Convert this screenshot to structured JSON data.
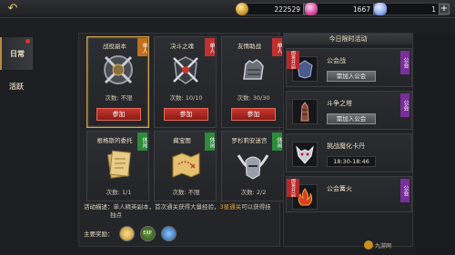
{
  "topbar": {
    "back_icon": "back-arrow-icon",
    "resources": [
      {
        "name": "gold",
        "icon": "gold-coin-icon",
        "value": "222529"
      },
      {
        "name": "gem",
        "icon": "pink-gem-icon",
        "value": "1667"
      },
      {
        "name": "crystal",
        "icon": "blue-crystal-icon",
        "value": "1"
      }
    ],
    "plus": "+"
  },
  "sidebar": {
    "tabs": [
      {
        "label": "日常",
        "active": true
      },
      {
        "label": "活跃",
        "active": false
      }
    ]
  },
  "cards": [
    {
      "title": "战役副本",
      "tag": "单人",
      "tag_type": "solo",
      "count": "次数: 不限",
      "button": "参加",
      "art": "shield-axes-icon",
      "selected": true
    },
    {
      "title": "决斗之魂",
      "tag": "单人",
      "tag_type": "team",
      "count": "次数: 10/10",
      "button": "参加",
      "art": "crossed-swords-shield-icon",
      "selected": false
    },
    {
      "title": "友情助战",
      "tag": "单人",
      "tag_type": "team",
      "count": "次数: 30/30",
      "button": "参加",
      "art": "gauntlet-icon",
      "selected": false
    },
    {
      "title": "根格斯的委托",
      "tag": "休闲",
      "tag_type": "rest",
      "count": "次数: 1/1",
      "button": "",
      "art": "scroll-paper-icon",
      "selected": false
    },
    {
      "title": "藏宝图",
      "tag": "休闲",
      "tag_type": "rest",
      "count": "次数: 不限",
      "button": "",
      "art": "treasure-map-icon",
      "selected": false
    },
    {
      "title": "罗杉莉安迷宫",
      "tag": "休闲",
      "tag_type": "rest",
      "count": "次数: 2/2",
      "button": "",
      "art": "horned-helmet-icon",
      "selected": false
    }
  ],
  "description": {
    "label": "活动描述：",
    "text_a": "单人精英副本，首次通关获得大量经验，",
    "text_hi": "3星通关",
    "text_b": "可以获得挂",
    "text_c": "独点"
  },
  "rewards": {
    "label": "主要奖励：",
    "items": [
      {
        "icon": "gold-medal-icon",
        "text": ""
      },
      {
        "icon": "exp-icon",
        "text": "EXP"
      },
      {
        "icon": "blue-orb-icon",
        "text": ""
      }
    ]
  },
  "events_panel": {
    "title": "今日限时活动",
    "events": [
      {
        "name": "公会战",
        "ribbon": "即将开启",
        "action": "需加入公会",
        "type": "button",
        "tag": "公会",
        "art": "guild-helm-icon"
      },
      {
        "name": "斗争之塔",
        "ribbon": "",
        "action": "需加入公会",
        "type": "button",
        "tag": "公会",
        "art": "tower-icon"
      },
      {
        "name": "挑战魔化卡丹",
        "ribbon": "",
        "action": "18:30-18:46",
        "type": "time",
        "tag": "",
        "art": "demon-face-icon"
      },
      {
        "name": "公会篝火",
        "ribbon": "即将开启",
        "action": "",
        "type": "none",
        "tag": "公会",
        "art": "bonfire-icon"
      }
    ]
  },
  "watermark": "九游网",
  "colors": {
    "accent_gold": "#d4a650",
    "join_red": "#c8362e",
    "guild_purple": "#7a2e9a",
    "rest_green": "#2e8a3a"
  }
}
